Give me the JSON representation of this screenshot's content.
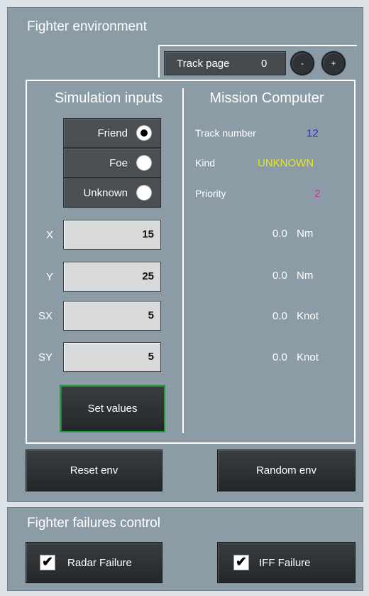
{
  "env": {
    "title": "Fighter environment",
    "track_page": {
      "label": "Track page",
      "value": "0",
      "minus": "-",
      "plus": "+"
    }
  },
  "sim": {
    "title": "Simulation inputs",
    "kinds": [
      {
        "label": "Friend",
        "selected": true
      },
      {
        "label": "Foe",
        "selected": false
      },
      {
        "label": "Unknown",
        "selected": false
      }
    ],
    "fields": [
      {
        "label": "X",
        "value": "15"
      },
      {
        "label": "Y",
        "value": "25"
      },
      {
        "label": "SX",
        "value": "5"
      },
      {
        "label": "SY",
        "value": "5"
      }
    ],
    "set_button": "Set values"
  },
  "mc": {
    "title": "Mission Computer",
    "track_number": {
      "label": "Track number",
      "value": "12",
      "color": "#2f33b5"
    },
    "kind": {
      "label": "Kind",
      "value": "UNKNOWN",
      "color": "#e6e61a"
    },
    "priority": {
      "label": "Priority",
      "value": "2",
      "color": "#cc2fa6"
    },
    "readouts": [
      {
        "value": "0.0",
        "unit": "Nm"
      },
      {
        "value": "0.0",
        "unit": "Nm"
      },
      {
        "value": "0.0",
        "unit": "Knot"
      },
      {
        "value": "0.0",
        "unit": "Knot"
      }
    ]
  },
  "actions": {
    "reset": "Reset env",
    "random": "Random env"
  },
  "failures": {
    "title": "Fighter failures control",
    "items": [
      {
        "label": "Radar Failure",
        "checked": true,
        "mark": "✔"
      },
      {
        "label": "IFF Failure",
        "checked": true,
        "mark": "✔"
      }
    ]
  }
}
